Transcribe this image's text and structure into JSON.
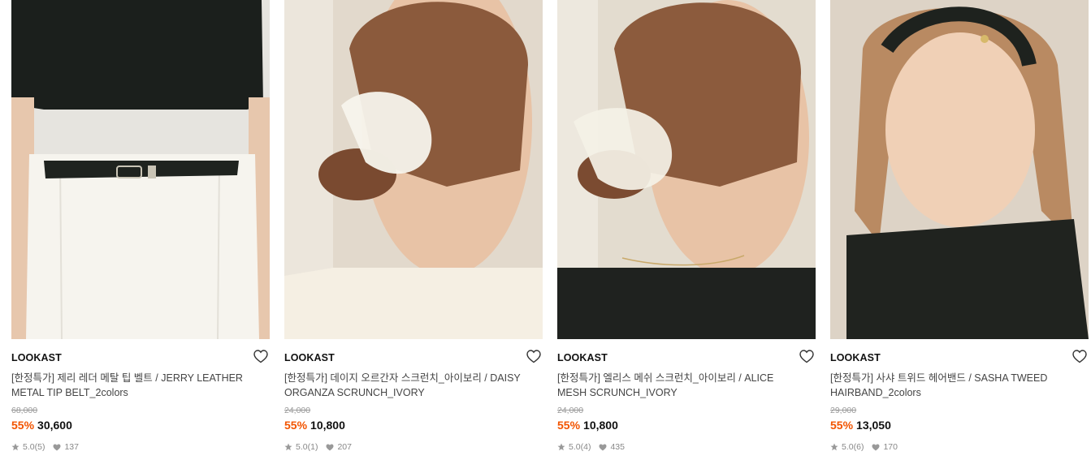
{
  "products": [
    {
      "brand": "LOOKAST",
      "name": "[한정특가] 제리 레더 메탈 팁 벨트 / JERRY LEATHER METAL TIP BELT_2colors",
      "original_price": "68,000",
      "discount": "55%",
      "price": "30,600",
      "rating": "5.0",
      "review_count": "(5)",
      "likes": "137",
      "image": "belt-photo"
    },
    {
      "brand": "LOOKAST",
      "name": "[한정특가] 데이지 오르간자 스크런치_아이보리 / DAISY ORGANZA SCRUNCH_IVORY",
      "original_price": "24,000",
      "discount": "55%",
      "price": "10,800",
      "rating": "5.0",
      "review_count": "(1)",
      "likes": "207",
      "image": "scrunchie-ivory-top-photo"
    },
    {
      "brand": "LOOKAST",
      "name": "[한정특가] 엘리스 메쉬 스크런치_아이보리 / ALICE MESH SCRUNCH_IVORY",
      "original_price": "24,000",
      "discount": "55%",
      "price": "10,800",
      "rating": "5.0",
      "review_count": "(4)",
      "likes": "435",
      "image": "scrunchie-black-top-photo"
    },
    {
      "brand": "LOOKAST",
      "name": "[한정특가] 사샤 트위드 헤어밴드 / SASHA TWEED HAIRBAND_2colors",
      "original_price": "29,000",
      "discount": "55%",
      "price": "13,050",
      "rating": "5.0",
      "review_count": "(6)",
      "likes": "170",
      "image": "hairband-photo"
    }
  ],
  "colors": {
    "discount": "#f25400",
    "price": "#111111",
    "muted": "#999999"
  }
}
